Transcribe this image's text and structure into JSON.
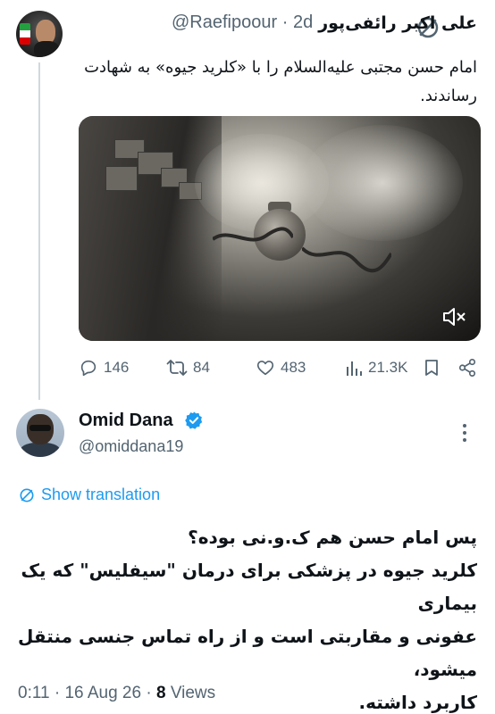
{
  "parent": {
    "author_name": "علی اکبر رائفی‌پور",
    "handle": "@Raefipoour",
    "separator": "·",
    "time": "2d",
    "text": "امام حسن مجتبی علیه‌السلام را با «کلرید جیوه» به شهادت رساندند.",
    "media_state": "muted",
    "stats": {
      "replies": "146",
      "retweets": "84",
      "likes": "483",
      "views": "21.3K"
    },
    "icons": [
      "grok-icon",
      "reply-icon",
      "retweet-icon",
      "like-icon",
      "views-icon",
      "bookmark-icon",
      "share-icon",
      "mute-icon"
    ]
  },
  "reply": {
    "author_name": "Omid Dana",
    "handle": "@omiddana19",
    "verified": true,
    "show_translation": "Show translation",
    "lines": [
      "پس امام حسن هم ک.و.نی بوده؟",
      "کلرید جیوه در پزشکی برای درمان \"سیفلیس\" که یک بیماری",
      "عفونی و مقاربتی است و از راه تماس جنسی منتقل میشود،",
      "کاربرد داشته."
    ],
    "meta": {
      "time": "0:11",
      "dot1": "·",
      "date": "16 Aug 26",
      "dot2": "·",
      "views_count": "8",
      "views_label": "Views"
    }
  },
  "colors": {
    "link": "#1d9bf0",
    "muted_text": "#536471",
    "primary_text": "#0f1419",
    "thread_line": "#cfd9de"
  }
}
